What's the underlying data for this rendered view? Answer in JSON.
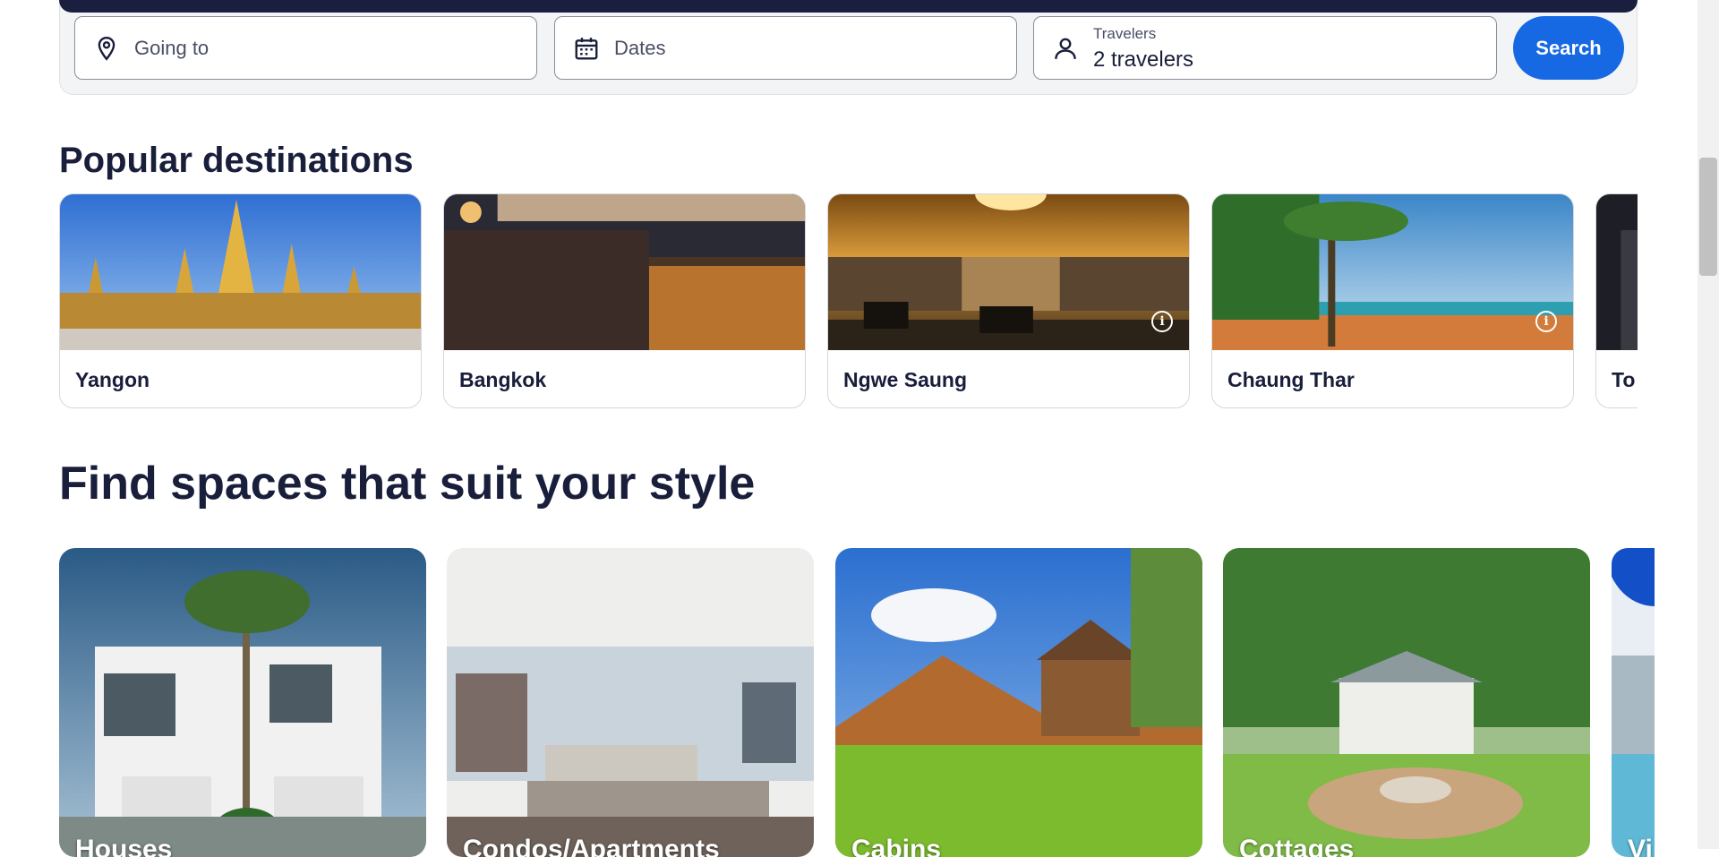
{
  "search": {
    "destination_placeholder": "Going to",
    "dates_label": "Dates",
    "travelers_label": "Travelers",
    "travelers_value": "2 travelers",
    "search_button": "Search"
  },
  "popular": {
    "title": "Popular destinations",
    "items": [
      {
        "name": "Yangon"
      },
      {
        "name": "Bangkok"
      },
      {
        "name": "Ngwe Saung"
      },
      {
        "name": "Chaung Thar"
      },
      {
        "name": "To"
      }
    ]
  },
  "spaces": {
    "title": "Find spaces that suit your style",
    "items": [
      {
        "name": "Houses"
      },
      {
        "name": "Condos/Apartments"
      },
      {
        "name": "Cabins"
      },
      {
        "name": "Cottages"
      },
      {
        "name": "Vi"
      }
    ]
  },
  "colors": {
    "accent": "#1668e3",
    "text": "#191e3b"
  }
}
